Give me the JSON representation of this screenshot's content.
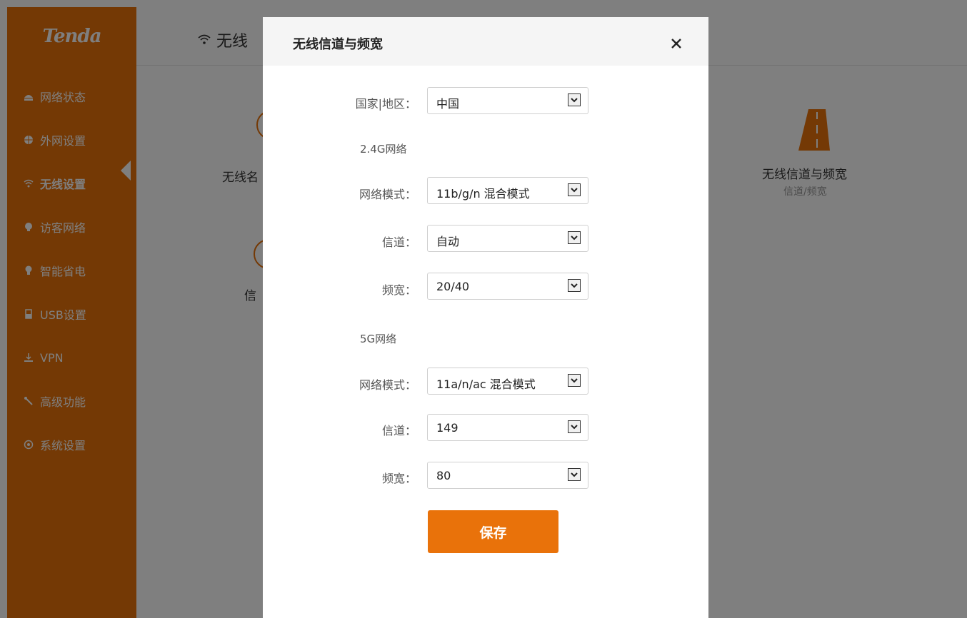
{
  "brand": {
    "logo_text": "Tenda"
  },
  "sidebar": {
    "items": [
      {
        "label": "网络状态",
        "icon": "status-icon"
      },
      {
        "label": "外网设置",
        "icon": "globe-icon"
      },
      {
        "label": "无线设置",
        "icon": "wifi-icon",
        "active": true
      },
      {
        "label": "访客网络",
        "icon": "guest-icon"
      },
      {
        "label": "智能省电",
        "icon": "bulb-icon"
      },
      {
        "label": "USB设置",
        "icon": "usb-icon"
      },
      {
        "label": "VPN",
        "icon": "vpn-icon"
      },
      {
        "label": "高级功能",
        "icon": "tools-icon"
      },
      {
        "label": "系统设置",
        "icon": "gear-icon"
      }
    ]
  },
  "page": {
    "title": "无线",
    "cards": [
      {
        "label": "无线名"
      },
      {
        "label": "信"
      },
      {
        "label": "无线信道与频宽",
        "sub": "信道/频宽"
      }
    ]
  },
  "modal": {
    "title": "无线信道与频宽",
    "country": {
      "label": "国家|地区：",
      "value": "中国"
    },
    "band24": {
      "section": "2.4G网络",
      "mode": {
        "label": "网络模式：",
        "value": "11b/g/n 混合模式"
      },
      "channel": {
        "label": "信道：",
        "value": "自动"
      },
      "bandwidth": {
        "label": "频宽：",
        "value": "20/40"
      }
    },
    "band5": {
      "section": "5G网络",
      "mode": {
        "label": "网络模式：",
        "value": "11a/n/ac 混合模式"
      },
      "channel": {
        "label": "信道：",
        "value": "149"
      },
      "bandwidth": {
        "label": "频宽：",
        "value": "80"
      }
    },
    "save_label": "保存"
  },
  "colors": {
    "accent": "#e9720a",
    "overlay": "rgba(0,0,0,0.5)"
  }
}
